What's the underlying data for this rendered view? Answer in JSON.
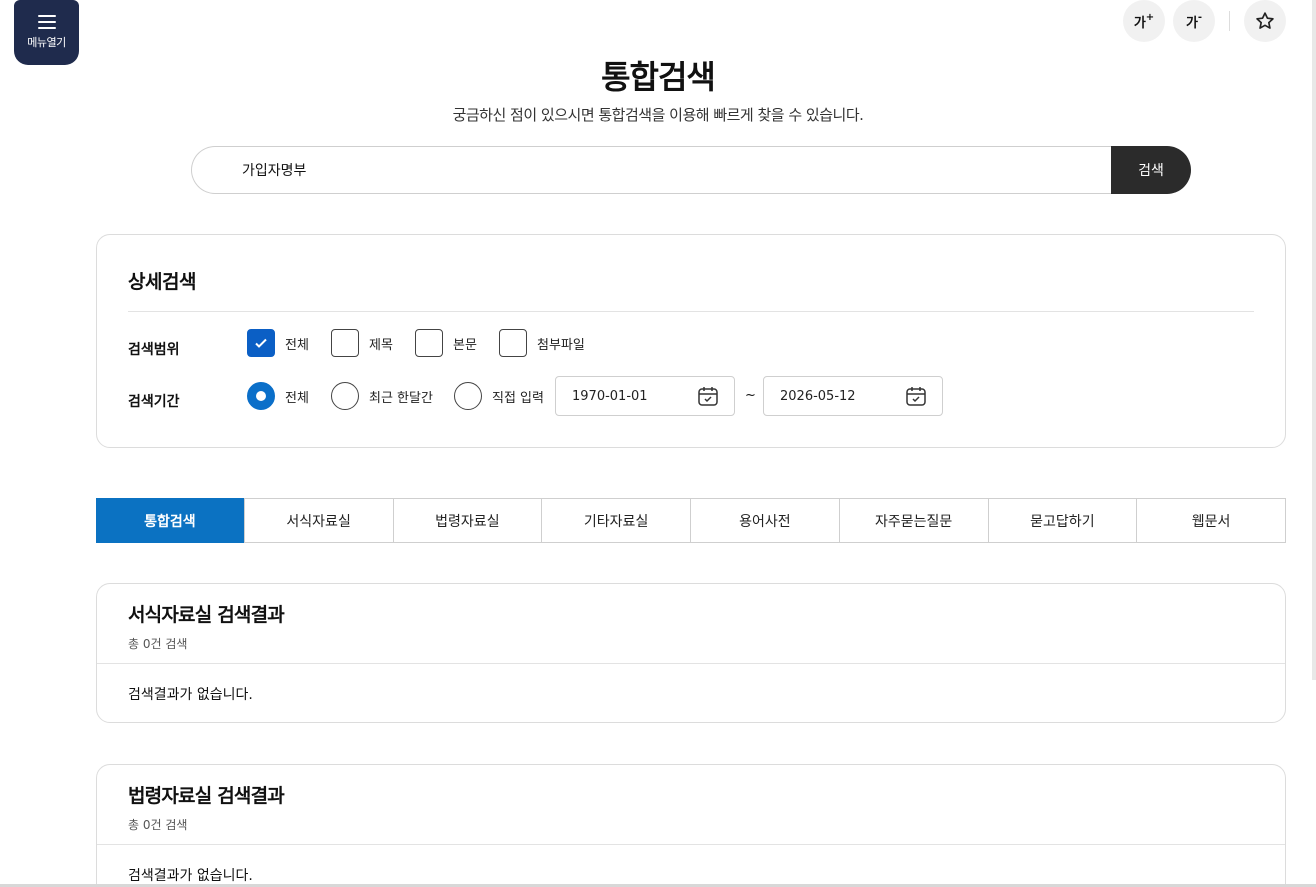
{
  "menu": {
    "label": "메뉴열기"
  },
  "tools": {
    "font_increase": "가",
    "font_increase_sup": "+",
    "font_decrease": "가",
    "font_decrease_sup": "-"
  },
  "header": {
    "title": "통합검색",
    "subtitle": "궁금하신 점이 있으시면 통합검색을 이용해 빠르게 찾을 수 있습니다."
  },
  "search": {
    "value": "가입자명부",
    "button_label": "검색"
  },
  "detail": {
    "title": "상세검색",
    "scope": {
      "label": "검색범위",
      "options": [
        {
          "label": "전체",
          "checked": true
        },
        {
          "label": "제목",
          "checked": false
        },
        {
          "label": "본문",
          "checked": false
        },
        {
          "label": "첨부파일",
          "checked": false
        }
      ]
    },
    "period": {
      "label": "검색기간",
      "options": [
        {
          "label": "전체",
          "selected": true
        },
        {
          "label": "최근 한달간",
          "selected": false
        },
        {
          "label": "직접 입력",
          "selected": false
        }
      ],
      "start_date": "1970-01-01",
      "end_date": "2026-05-12",
      "separator": "~"
    }
  },
  "tabs": [
    {
      "label": "통합검색",
      "active": true
    },
    {
      "label": "서식자료실",
      "active": false
    },
    {
      "label": "법령자료실",
      "active": false
    },
    {
      "label": "기타자료실",
      "active": false
    },
    {
      "label": "용어사전",
      "active": false
    },
    {
      "label": "자주묻는질문",
      "active": false
    },
    {
      "label": "묻고답하기",
      "active": false
    },
    {
      "label": "웹문서",
      "active": false
    }
  ],
  "results": [
    {
      "title": "서식자료실 검색결과",
      "count": "총 0건 검색",
      "empty": "검색결과가 없습니다."
    },
    {
      "title": "법령자료실 검색결과",
      "count": "총 0건 검색",
      "empty": "검색결과가 없습니다."
    }
  ],
  "colors": {
    "accent": "#0b72c2",
    "menu_bg": "#1f2b4d",
    "search_btn": "#2b2b2b"
  }
}
